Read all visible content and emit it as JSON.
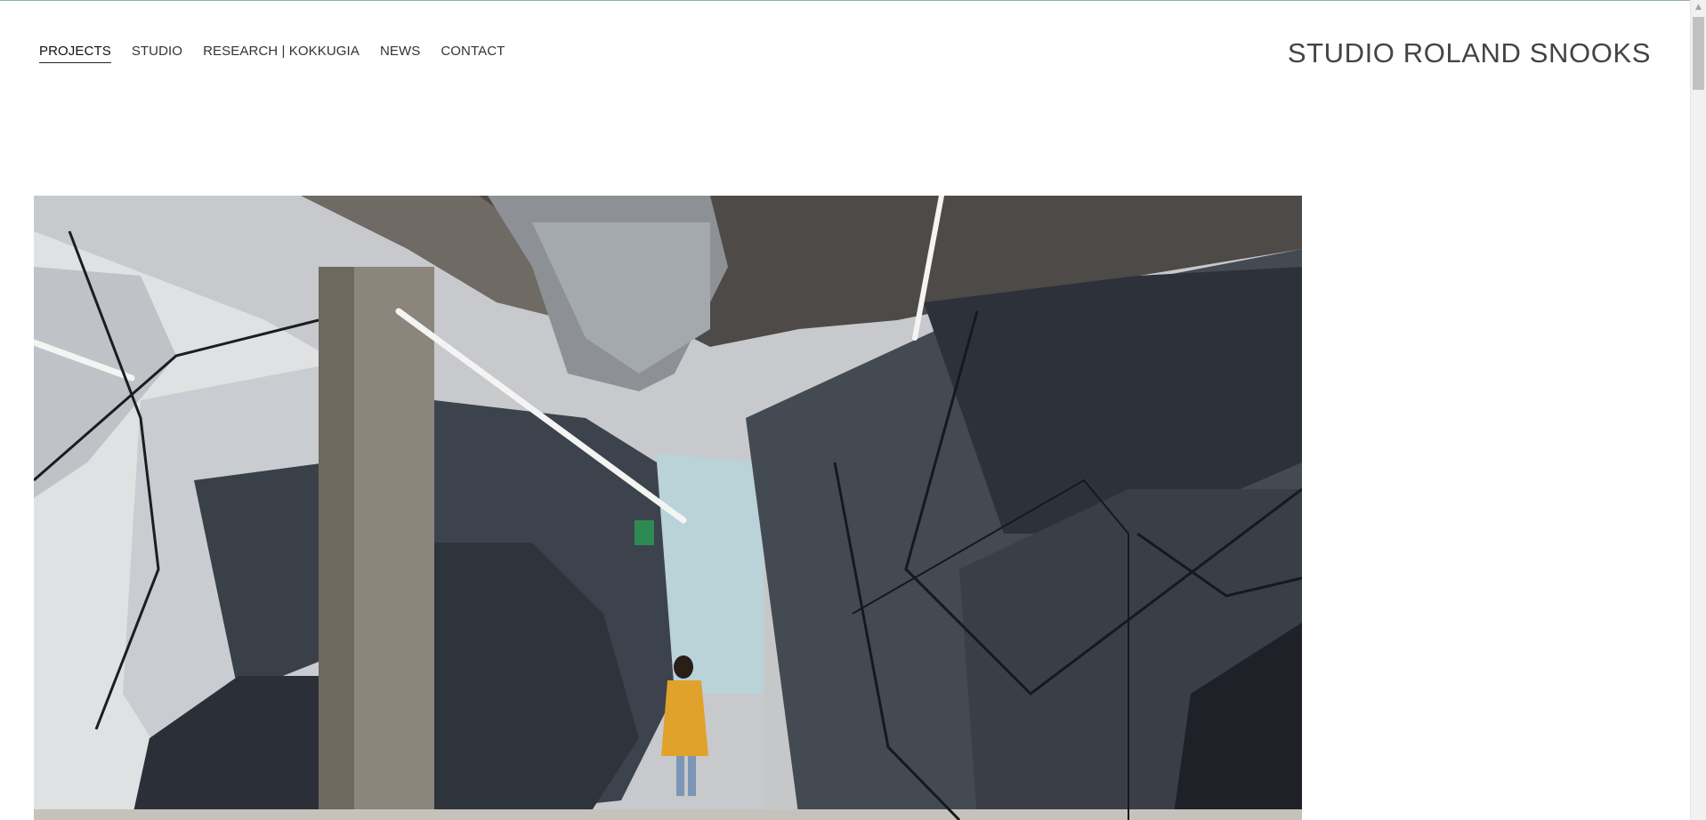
{
  "nav": {
    "items": [
      {
        "label": "PROJECTS",
        "active": true
      },
      {
        "label": "STUDIO",
        "active": false
      },
      {
        "label": "RESEARCH | KOKKUGIA",
        "active": false
      },
      {
        "label": "NEWS",
        "active": false
      },
      {
        "label": "CONTACT",
        "active": false
      }
    ]
  },
  "brand": {
    "name": "STUDIO ROLAND SNOOKS"
  },
  "hero": {
    "subject": "interior photograph: faceted grey wall panels, concrete column and ceiling, person in yellow coat walking"
  },
  "colors": {
    "text": "#333333",
    "brand_text": "#444444",
    "background": "#ffffff",
    "accent_coat": "#e0a22a"
  },
  "icons": {
    "scroll_up": "triangle-up-icon"
  }
}
